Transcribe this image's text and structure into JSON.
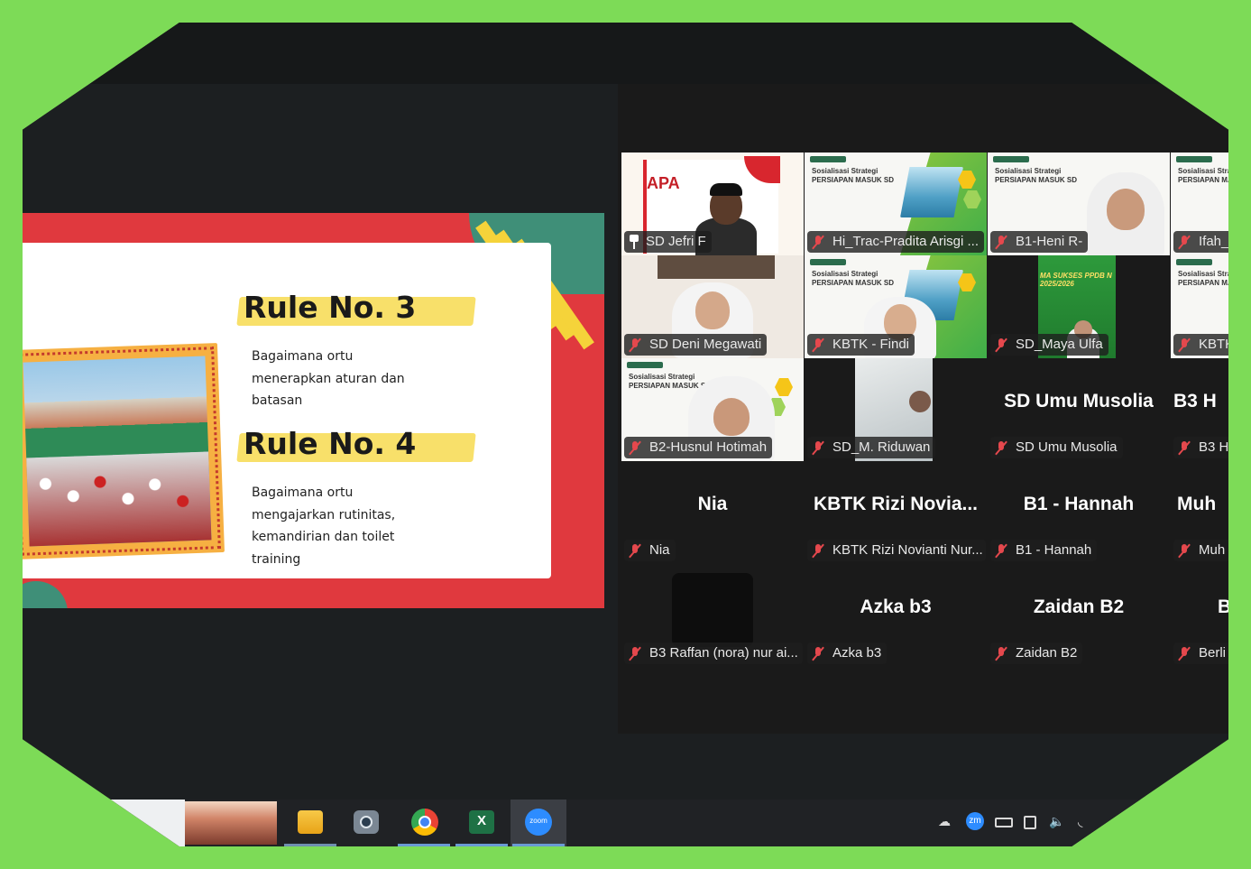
{
  "slide": {
    "rule3_title": "Rule No. 3",
    "rule3_text": "Bagaimana ortu menerapkan aturan dan batasan",
    "rule4_title": "Rule No. 4",
    "rule4_text": "Bagaimana ortu mengajarkan rutinitas, kemandirian dan toilet training"
  },
  "participants": [
    {
      "label": "SD Jefri F",
      "pinned": true,
      "active": true
    },
    {
      "label": "Hi_Trac-Pradita Arisgi ..."
    },
    {
      "label": "B1-Heni R-"
    },
    {
      "label": "Ifah_"
    },
    {
      "label": "SD Deni Megawati"
    },
    {
      "label": "KBTK - Findi"
    },
    {
      "label": "SD_Maya Ulfa"
    },
    {
      "label": "KBTK"
    },
    {
      "label": "B2-Husnul Hotimah"
    },
    {
      "label": "SD_M. Riduwan"
    },
    {
      "label": "SD Umu Musolia",
      "big": "SD Umu Musolia"
    },
    {
      "label": "B3 H",
      "big": "B3 H"
    },
    {
      "label": "Nia",
      "big": "Nia"
    },
    {
      "label": "KBTK Rizi Novianti Nur...",
      "big": "KBTK Rizi Novia..."
    },
    {
      "label": "B1 - Hannah",
      "big": "B1 - Hannah"
    },
    {
      "label": "Muh",
      "big": "Muh"
    },
    {
      "label": "B3 Raffan (nora) nur ai..."
    },
    {
      "label": "Azka b3",
      "big": "Azka b3"
    },
    {
      "label": "Zaidan B2",
      "big": "Zaidan B2"
    },
    {
      "label": "Berli",
      "big": "B"
    }
  ],
  "thumb_slide": {
    "title_line1": "Sosialisasi Strategi",
    "title_line2": "PERSIAPAN MASUK SD"
  },
  "maya_slide_text": "MA SUKSES PPDB N 2025/2026",
  "taskbar": {
    "zoom_label": "zoom",
    "excel_label": "X",
    "tray_zm": "zm"
  },
  "colors": {
    "background_green": "#7ddb57",
    "active_speaker": "#23d96b",
    "muted_red": "#e5484d",
    "slide_red": "#e0393e",
    "slide_teal": "#3f8f78",
    "highlight_yellow": "#f8e06a"
  }
}
